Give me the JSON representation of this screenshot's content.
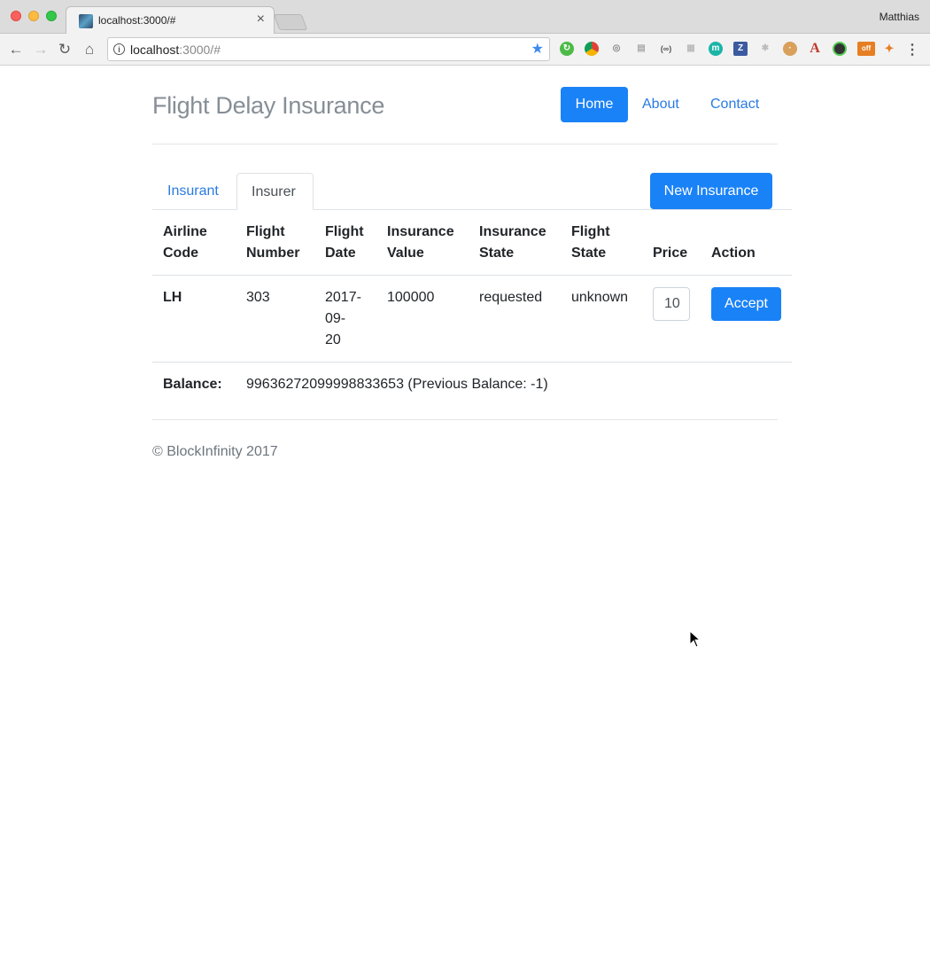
{
  "browser": {
    "tab_title": "localhost:3000/#",
    "tab_close": "×",
    "profile": "Matthias",
    "url_host": "localhost",
    "url_rest": ":3000/#",
    "icons": [
      "back-icon",
      "forward-icon",
      "reload-icon",
      "home-icon",
      "info-icon",
      "star-icon",
      "menu-icon"
    ]
  },
  "header": {
    "brand": "Flight Delay Insurance",
    "nav": {
      "home": "Home",
      "about": "About",
      "contact": "Contact"
    }
  },
  "tabs": {
    "insurant": "Insurant",
    "insurer": "Insurer"
  },
  "new_insurance_label": "New Insurance",
  "table": {
    "headers": {
      "airline_code": [
        "Airline",
        "Code"
      ],
      "flight_number": [
        "Flight",
        "Number"
      ],
      "flight_date": [
        "Flight",
        "Date"
      ],
      "insurance_value": [
        "Insurance",
        "Value"
      ],
      "insurance_state": [
        "Insurance",
        "State"
      ],
      "flight_state": [
        "Flight",
        "State"
      ],
      "price": "Price",
      "action": "Action"
    },
    "rows": [
      {
        "airline_code": "LH",
        "flight_number": "303",
        "flight_date": [
          "2017-",
          "09-",
          "20"
        ],
        "insurance_value": "100000",
        "insurance_state": "requested",
        "flight_state": "unknown",
        "price": "10",
        "action_label": "Accept"
      }
    ]
  },
  "balance": {
    "label": "Balance:",
    "value": "99636272099998833653 (Previous Balance: -1)"
  },
  "footer": "© BlockInfinity 2017",
  "colors": {
    "primary": "#1a82f7",
    "link": "#2a7ae2",
    "brand_text": "#868e96"
  }
}
